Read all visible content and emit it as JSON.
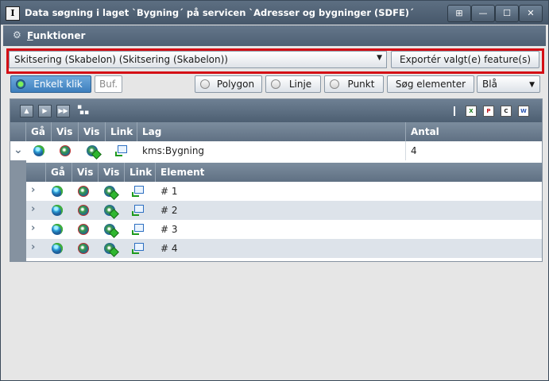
{
  "window": {
    "title": "Data søgning i laget `Bygning´ på servicen `Adresser og bygninger (SDFE)´",
    "app_icon": "I",
    "controls": {
      "pin": "⊞",
      "minimize": "—",
      "maximize": "☐",
      "close": "✕"
    }
  },
  "menu": {
    "label": "Funktioner"
  },
  "template": {
    "selected": "Skitsering (Skabelon) (Skitsering (Skabelon))",
    "arrow": "▼"
  },
  "export_button": "Exportér valgt(e) feature(s)",
  "toolbar": {
    "enkelt_klik": "Enkelt klik",
    "buf": "Buf.",
    "polygon": "Polygon",
    "linje": "Linje",
    "punkt": "Punkt",
    "soeg": "Søg elementer",
    "color": "Blå",
    "color_arrow": "▼"
  },
  "grid": {
    "columns": [
      "Gå",
      "Vis",
      "Vis",
      "Link",
      "Lag",
      "Antal"
    ],
    "layer_row": {
      "lag": "kms:Bygning",
      "antal": "4",
      "expander": "⌄"
    },
    "sub_columns": [
      "Gå",
      "Vis",
      "Vis",
      "Link",
      "Element"
    ],
    "elements": [
      {
        "label": "# 1",
        "expander": "›"
      },
      {
        "label": "# 2",
        "expander": "›"
      },
      {
        "label": "# 3",
        "expander": "›"
      },
      {
        "label": "# 4",
        "expander": "›"
      }
    ]
  },
  "icons": {
    "toolbar_nav": [
      "collapse-icon",
      "next-icon",
      "last-icon",
      "tree-icon"
    ],
    "export_icons": [
      "excel-icon",
      "pdf-icon",
      "csv-icon",
      "word-icon"
    ],
    "row_icons": [
      "globe-icon",
      "vis-icon",
      "vis-add-icon",
      "link-icon"
    ]
  },
  "colors": {
    "accent_red": "#d40e15",
    "selected_blue": "#3d7fbd",
    "header": "#5f7083",
    "row_alt": "#dde3ea"
  }
}
